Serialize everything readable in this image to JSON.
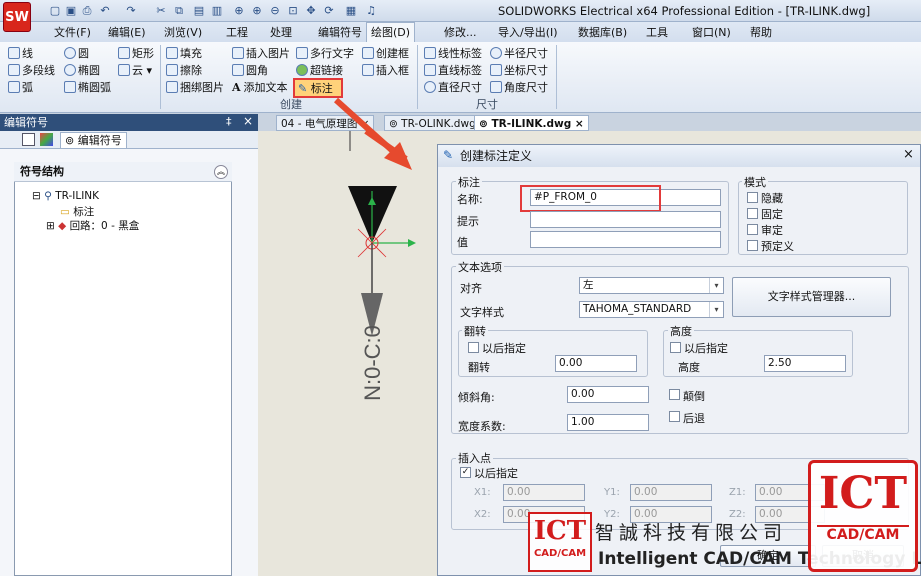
{
  "window": {
    "app_logo": "SW",
    "title": "SOLIDWORKS Electrical x64 Professional Edition - [TR-ILINK.dwg]"
  },
  "menu": [
    "文件(F)",
    "编辑(E)",
    "浏览(V)",
    "工程",
    "处理",
    "编辑符号",
    "绘图(D)",
    "修改...",
    "导入/导出(I)",
    "数据库(B)",
    "工具",
    "窗口(N)",
    "帮助"
  ],
  "ribbon": {
    "draw": [
      "线",
      "圆",
      "矩形",
      "多段线",
      "椭圆",
      "云",
      "弧",
      "椭圆弧"
    ],
    "create": [
      "填充",
      "插入图片",
      "多行文字",
      "创建框",
      "擦除",
      "圆角",
      "超链接",
      "插入框",
      "捆绑图片",
      "添加文本",
      "标注"
    ],
    "create_group": "创建",
    "dimension": [
      "线性标签",
      "半径尺寸",
      "直线标签",
      "坐标尺寸",
      "直径尺寸",
      "角度尺寸"
    ],
    "dimension_group": "尺寸"
  },
  "left_panel": {
    "title": "编辑符号",
    "pin": "‡",
    "close": "×",
    "tab": "编辑符号",
    "tree_header": "符号结构",
    "tree": [
      "TR-ILINK",
      "标注",
      "回路：0 - 黑盒"
    ]
  },
  "doc_tabs": [
    "04 - 电气原理图",
    "TR-OLINK.dwg",
    "TR-ILINK.dwg"
  ],
  "canvas": {
    "vertical_text": "N:0-C:0"
  },
  "dialog": {
    "title": "创建标注定义",
    "close": "×",
    "label_group": "标注",
    "name_label": "名称:",
    "name_value": "#P_FROM_0",
    "hint_label": "提示",
    "value_label": "值",
    "mode_group": "模式",
    "modes": [
      "隐藏",
      "固定",
      "审定",
      "预定义"
    ],
    "text_group": "文本选项",
    "align_label": "对齐",
    "align_value": "左",
    "style_label": "文字样式",
    "style_value": "TAHOMA_STANDARD",
    "style_manager_button": "文字样式管理器...",
    "flip_group": "翻转",
    "flip_later": "以后指定",
    "flip_label": "翻转",
    "flip_value": "0.00",
    "height_group": "高度",
    "height_later": "以后指定",
    "height_label": "高度",
    "height_value": "2.50",
    "oblique_label": "倾斜角:",
    "oblique_value": "0.00",
    "upside_down": "颠倒",
    "width_label": "宽度系数:",
    "width_value": "1.00",
    "backward": "后退",
    "insert_group": "插入点",
    "insert_later": "以后指定",
    "coords": [
      "X1:",
      "Y1:",
      "Z1:",
      "X2:",
      "Y2:",
      "Z2:"
    ],
    "coord_value": "0.00",
    "ok": "确定",
    "cancel": "取消"
  },
  "watermark": {
    "logo": "ICT",
    "logo_sub": "CAD/CAM",
    "company_cn": "智誠科技有限公司",
    "company_en": "Intelligent CAD/CAM Technology Ltd."
  },
  "colors": {
    "highlight": "#e23a3a",
    "accent": "#2f4f7a",
    "brand": "#d21c1c"
  }
}
